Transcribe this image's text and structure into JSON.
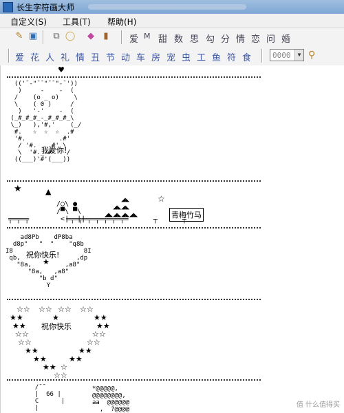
{
  "window": {
    "title": "长生字符画大师"
  },
  "menu": {
    "items": [
      "自定义(S)",
      "工具(T)",
      "帮助(H)"
    ]
  },
  "toolbar1": {
    "categories": [
      "爱",
      "M",
      "甜",
      "数",
      "思",
      "勾",
      "分",
      "情",
      "恋",
      "问",
      "婚"
    ]
  },
  "toolbar2": {
    "categories": [
      "爱",
      "花",
      "人",
      "礼",
      "情",
      "丑",
      "节",
      "动",
      "车",
      "房",
      "宠",
      "虫",
      "工",
      "鱼",
      "符",
      "食"
    ],
    "size_value": "0000"
  },
  "content": {
    "bear_text": "我爱你!",
    "bear_art": [
      "  (('¯-\"¯¯\"¯¯\"-¯'))",
      "   )     -    -  (",
      "  /    (o _ o)    \\",
      "  \\    ( 0 )     /",
      "   )   '-'    -  (",
      " (_#_#_#_-_#_#_#_\\",
      " \\_)   ),'#,'    (_/",
      "  #.   ☆  ☆  ☆  .#",
      "  '#.         .#'",
      "   / '#.   .#' \\",
      "   \\  '#._.#'   /",
      "  ((___)'#'(___))"
    ],
    "scene_label": "青梅竹马",
    "wish_text_1": "祝你快乐!",
    "wish_text_2": "祝你快乐",
    "heart1_art": [
      "    ad8Pb    dP8ba",
      "  d8p\"   \"  \"    \"q8b",
      "I8                   8I",
      " qb,               ,dp",
      "   \"8a,         ,a8\"",
      "      \"8a,   ,a8\"",
      "         \"b d\"",
      "           Y"
    ],
    "bottom_left_art": [
      "  /¯¯",
      "  |  66 |",
      "  C      |",
      "  |"
    ],
    "bottom_right_art": [
      "*@@@@@,",
      "@@@@@@@@,",
      "aa  @@@@@@",
      "  ,  ?@@@@"
    ]
  },
  "watermark": "值 什么值得买"
}
